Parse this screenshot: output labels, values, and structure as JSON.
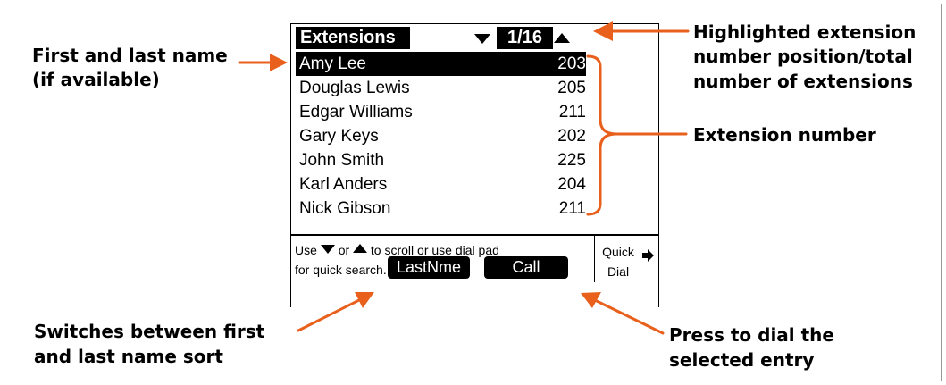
{
  "screen": {
    "title": "Extensions",
    "position": "1/16",
    "entries": [
      {
        "name": "Amy Lee",
        "ext": "203",
        "selected": true
      },
      {
        "name": "Douglas Lewis",
        "ext": "205",
        "selected": false
      },
      {
        "name": "Edgar Williams",
        "ext": "211",
        "selected": false
      },
      {
        "name": "Gary Keys",
        "ext": "202",
        "selected": false
      },
      {
        "name": "John Smith",
        "ext": "225",
        "selected": false
      },
      {
        "name": "Karl Anders",
        "ext": "204",
        "selected": false
      },
      {
        "name": "Nick Gibson",
        "ext": "211",
        "selected": false
      }
    ],
    "help_use": "Use",
    "help_or": "or",
    "help_rest": "to scroll or use dial pad",
    "help_line2": "for quick search.",
    "quick_line1": "Quick",
    "quick_line2": "Dial"
  },
  "softkeys": {
    "left": "LastNme",
    "right": "Call"
  },
  "annotations": {
    "first_name_1": "First and last name",
    "first_name_2": "(if available)",
    "highlight_1": "Highlighted extension",
    "highlight_2": "number position/total",
    "highlight_3": "number of extensions",
    "extension": "Extension number",
    "switch_1": "Switches between first",
    "switch_2": "and last name sort",
    "press_1": "Press to dial the",
    "press_2": "selected entry"
  },
  "colors": {
    "accent": "#e8601c",
    "screen_bg": "#ffffff",
    "selection": "#000000"
  }
}
